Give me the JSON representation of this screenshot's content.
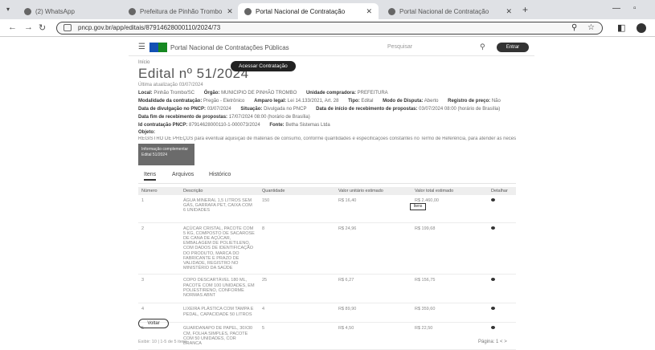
{
  "browser": {
    "tabs": [
      {
        "label": "(2) WhatsApp"
      },
      {
        "label": "Prefeitura de Pinhão Trombo"
      },
      {
        "label": "Portal Nacional de Contratação"
      },
      {
        "label": "Portal Nacional de Contratação"
      }
    ],
    "url": "pncp.gov.br/app/editais/87914628000110/2024/73"
  },
  "header": {
    "portal_name": "Portal Nacional de Contratações Públicas",
    "search_placeholder": "Pesquisar",
    "enter_label": "Entrar"
  },
  "breadcrumb": "Início",
  "title": "Edital nº 51/2024",
  "pncp_button": "Acessar Contratação",
  "id_line": "Última atualização 03/07/2024",
  "meta": {
    "local_label": "Local:",
    "local_value": "Pinhão Trombo/SC",
    "orgao_label": "Órgão:",
    "orgao_value": "MUNICIPIO DE PINHÃO TROMBO",
    "unidade_label": "Unidade compradora:",
    "unidade_value": "PREFEITURA",
    "modalidade_label": "Modalidade da contratação:",
    "modalidade_value": "Pregão - Eletrônico",
    "amparo_label": "Amparo legal:",
    "amparo_value": "Lei 14.133/2021, Art. 28",
    "tipo_label": "Tipo:",
    "tipo_value": "Edital",
    "disputa_label": "Modo de Disputa:",
    "disputa_value": "Aberto",
    "registro_label": "Registro de preço:",
    "registro_value": "Não",
    "divulgacao_label": "Data de divulgação no PNCP:",
    "divulgacao_value": "03/07/2024",
    "situacao_label": "Situação:",
    "situacao_value": "Divulgada no PNCP",
    "inicio_label": "Data de início de recebimento de propostas:",
    "inicio_value": "03/07/2024 08:00 (horário de Brasília)",
    "fim_label": "Data fim de recebimento de propostas:",
    "fim_value": "17/07/2024 08:00 (horário de Brasília)",
    "idpncp_label": "Id contratação PNCP:",
    "idpncp_value": "87914628000110-1-000073/2024",
    "fonte_label": "Fonte:",
    "fonte_value": "Betha Sistemas Ltda",
    "objeto_label": "Objeto:"
  },
  "objeto_text": "REGISTRO DE PREÇOS para eventual aquisição de materiais de consumo, conforme quantidades e especificações constantes no Termo de Referência, para atender as necessidades do Município de Pinhão Trombo/SC",
  "doc_block": [
    "Informação complementar",
    "Edital 51/2024"
  ],
  "tabs": [
    "Itens",
    "Arquivos",
    "Histórico"
  ],
  "table": {
    "headers": [
      "Número",
      "Descrição",
      "Quantidade",
      "Valor unitário estimado",
      "Valor total estimado",
      "Detalhar"
    ],
    "rows": [
      {
        "num": "1",
        "desc": "ÁGUA MINERAL 1,5 LITROS SEM GÁS, GARRAFA PET, CAIXA COM 6 UNIDADES",
        "qtd": "150",
        "unit": "R$ 16,40",
        "total": "R$ 2.460,00"
      },
      {
        "num": "2",
        "desc": "AÇÚCAR CRISTAL, PACOTE COM 5 KG, COMPOSTO DE SACAROSE DE CANA DE AÇÚCAR, EMBALAGEM DE POLIETILENO, COM DADOS DE IDENTIFICAÇÃO DO PRODUTO, MARCA DO FABRICANTE E PRAZO DE VALIDADE, REGISTRO NO MINISTÉRIO DA SAÚDE",
        "qtd": "8",
        "unit": "R$ 24,96",
        "total": "R$ 199,68"
      },
      {
        "num": "3",
        "desc": "COPO DESCARTÁVEL 180 ML, PACOTE COM 100 UNIDADES, EM POLIESTIRENO, CONFORME NORMAS ABNT",
        "qtd": "25",
        "unit": "R$ 6,27",
        "total": "R$ 156,75"
      },
      {
        "num": "4",
        "desc": "LIXEIRA PLÁSTICA COM TAMPA E PEDAL, CAPACIDADE 50 LITROS",
        "qtd": "4",
        "unit": "R$ 89,90",
        "total": "R$ 359,60"
      },
      {
        "num": "5",
        "desc": "GUARDANAPO DE PAPEL, 30X30 CM, FOLHA SIMPLES, PACOTE COM 50 UNIDADES, COR BRANCA",
        "qtd": "5",
        "unit": "R$ 4,50",
        "total": "R$ 22,50"
      }
    ],
    "tooltip": "Itens"
  },
  "pager": {
    "left": "Exibir: 10 | 1-5 de 5 itens",
    "right": "Página: 1   <   >"
  },
  "voltar_label": "Voltar"
}
